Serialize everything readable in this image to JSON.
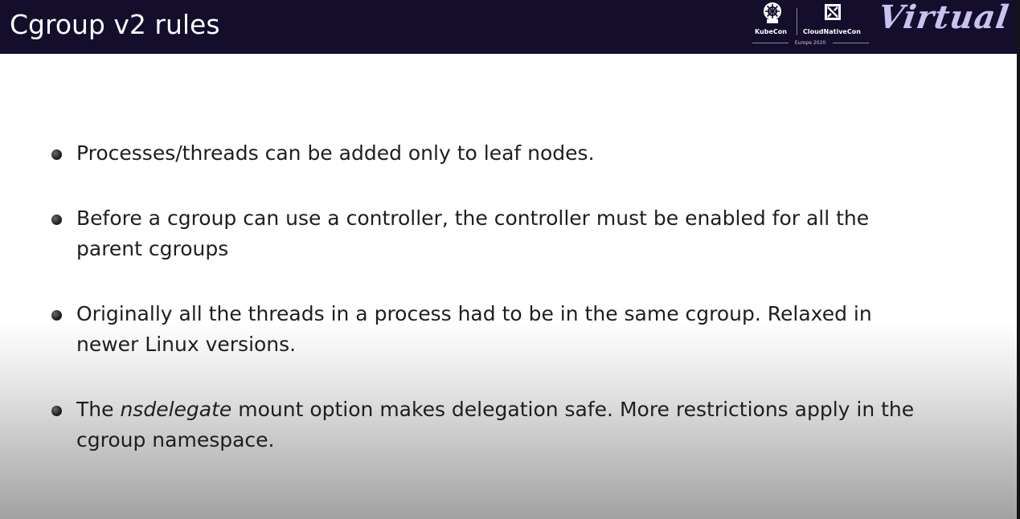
{
  "slide": {
    "title": "Cgroup v2 rules"
  },
  "branding": {
    "kubecon_label": "KubeCon",
    "cncf_label": "CloudNativeCon",
    "event_sub": "Europe 2020",
    "virtual_label": "Virtual",
    "header_color": "#140d2c",
    "virtual_color": "#c9c1ee"
  },
  "bullets": [
    {
      "text": "Processes/threads can be added only to leaf nodes."
    },
    {
      "line1": "Before a cgroup can use a controller, the controller must be enabled for all the",
      "line2": "parent cgroups"
    },
    {
      "line1": "Originally all the threads in a process had to be in the same cgroup. Relaxed in",
      "line2": "newer Linux versions."
    },
    {
      "pre": "The ",
      "em": "nsdelegate",
      "post": " mount option makes delegation safe. More restrictions apply in the",
      "line2": "cgroup namespace."
    }
  ]
}
